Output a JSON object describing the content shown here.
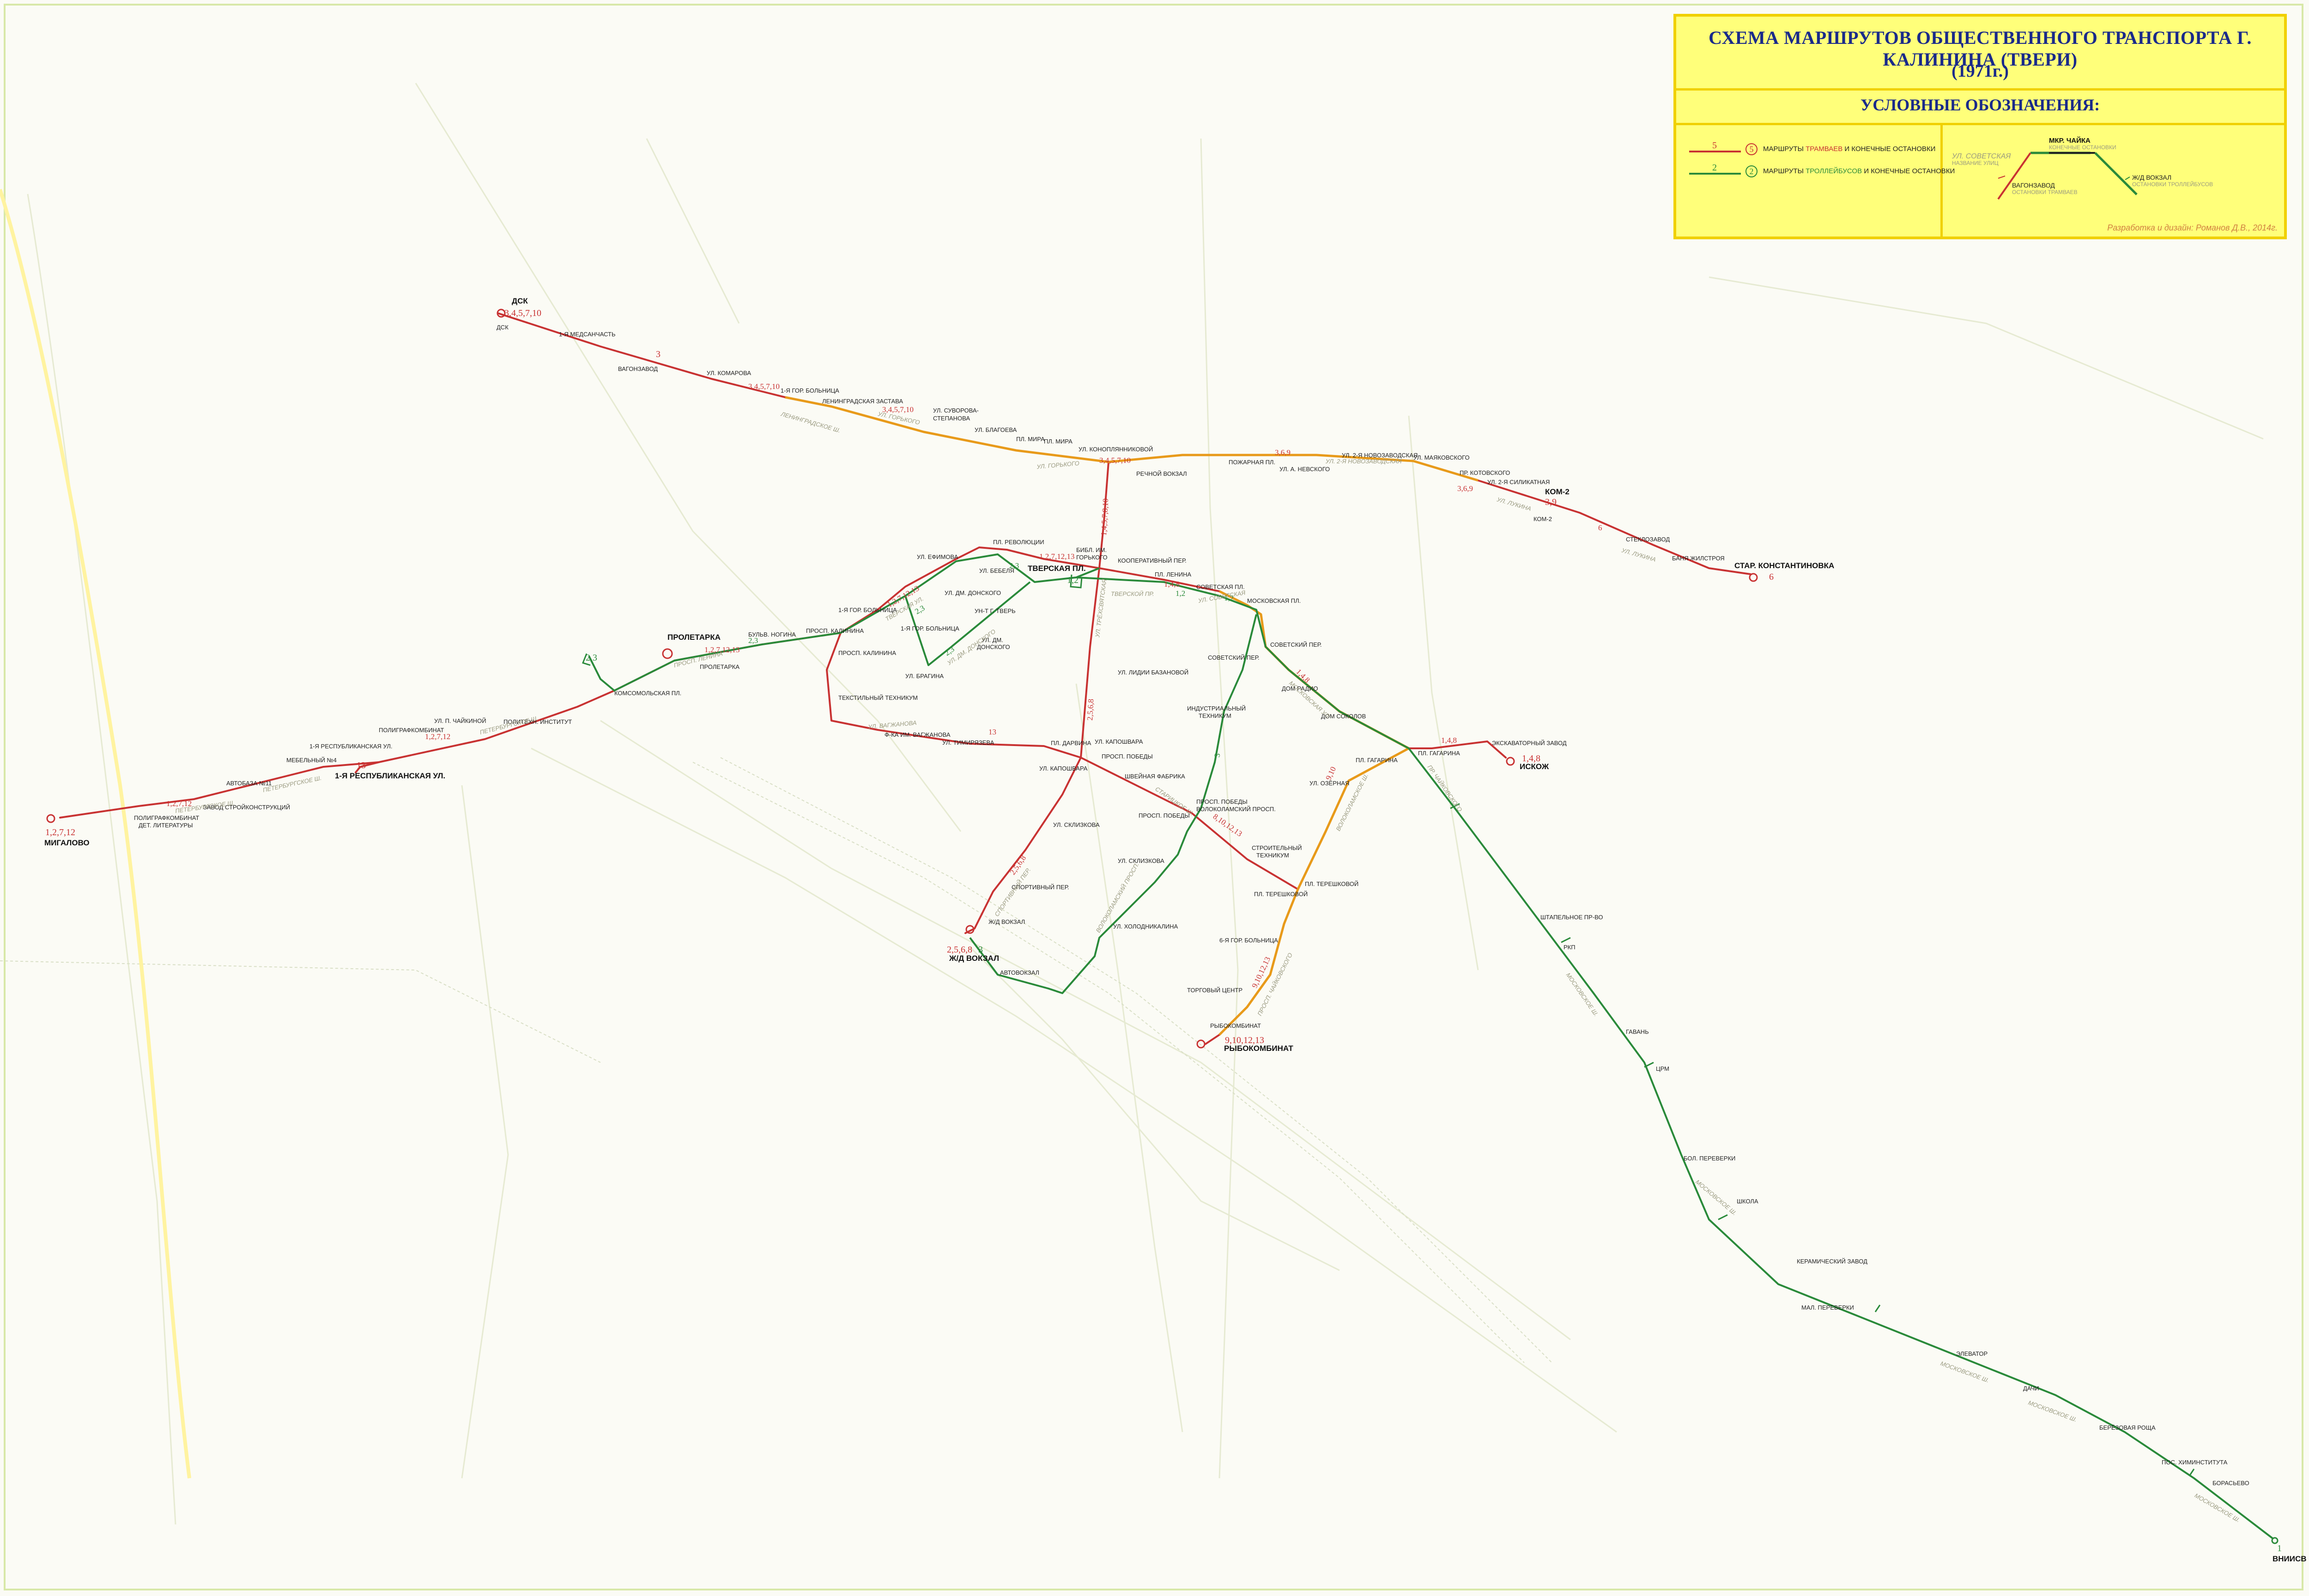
{
  "legend": {
    "title": "СХЕМА МАРШРУТОВ ОБЩЕСТВЕННОГО ТРАНСПОРТА Г. КАЛИНИНА (ТВЕРИ)",
    "year": "(1971г.)",
    "heading": "УСЛОВНЫЕ ОБОЗНАЧЕНИЯ:",
    "tram_row": {
      "num": "5",
      "circle": "5",
      "text_a": "МАРШРУТЫ ",
      "text_b": "ТРАМВАЕВ",
      "text_c": " И КОНЕЧНЫЕ ОСТАНОВКИ"
    },
    "trolley_row": {
      "num": "2",
      "circle": "2",
      "text_a": "МАРШРУТЫ ",
      "text_b": "ТРОЛЛЕЙБУСОВ",
      "text_c": " И КОНЕЧНЫЕ ОСТАНОВКИ"
    },
    "example": {
      "terminal": "МКР. ЧАЙКА",
      "terminal_sub": "КОНЕЧНЫЕ ОСТАНОВКИ",
      "street": "УЛ. СОВЕТСКАЯ",
      "street_sub": "НАЗВАНИЕ УЛИЦ",
      "tram_stop": "ВАГОНЗАВОД",
      "tram_stop_sub": "ОСТАНОВКИ ТРАМВАЕВ",
      "trolley_stop": "Ж/Д ВОКЗАЛ",
      "trolley_stop_sub": "ОСТАНОВКИ ТРОЛЛЕЙБУСОВ"
    },
    "credit": "Разработка и дизайн: Романов Д.В., 2014г."
  },
  "colors": {
    "tram": "#c83232",
    "trolley": "#2a8a3a",
    "shared": "#e89a1a",
    "legend_bg": "#ffff7a",
    "legend_border": "#f0d000",
    "title_blue": "#1a2a8a"
  },
  "terminals": {
    "dsk": {
      "name": "ДСК",
      "routes": "3,4,5,7,10"
    },
    "migalovo": {
      "name": "МИГАЛОВО",
      "routes": "1,2,7,12"
    },
    "resp": {
      "name": "1-Я РЕСПУБЛИКАНСКАЯ УЛ.",
      "routes": "13"
    },
    "proletarka": {
      "name": "ПРОЛЕТАРКА",
      "routes": "2,3"
    },
    "zhd": {
      "name": "Ж/Д ВОКЗАЛ",
      "routes": "2,5,6,8",
      "trolley": "3"
    },
    "rybokombinat": {
      "name": "РЫБОКОМБИНАТ",
      "routes": "9,10,12,13"
    },
    "iskozh": {
      "name": "ИСКОЖ",
      "routes": "1,4,8"
    },
    "starkonst": {
      "name": "СТАР. КОНСТАНТИНОВКА",
      "routes": "6"
    },
    "kom2": {
      "name": "КОМ-2",
      "routes": "3,9"
    },
    "vniisv": {
      "name": "ВНИИСВ",
      "trolley": "1"
    },
    "tverskaya": {
      "name": "ТВЕРСКАЯ ПЛ.",
      "trolley": "1,2"
    }
  },
  "route_labels": {
    "a": "3",
    "b": "3,4,5,7,10",
    "c": "3,4,5,7,10",
    "d": "3,4,5,7,10",
    "e": "3,6,9",
    "f": "3,6,9",
    "g": "6",
    "h": "1,4,5,7,8,10",
    "i": "1,4,8",
    "j": "1,4,8",
    "k": "1,2,7,12,13",
    "l": "1,2,7,12,13",
    "m": "1,2,7,12",
    "n": "1,2,7,12,13",
    "o": "2,5,6,8",
    "p": "2,5,6,8,9,10,12,13",
    "q": "8,10,12,13",
    "r": "9,10,12,13",
    "s": "13",
    "t": "1,4,8",
    "u": "3,9",
    "v": "1,2,7,12",
    "w": "9,10"
  },
  "trolley_labels": {
    "a": "2,3",
    "b": "1,2",
    "c": "2,3",
    "d": "2,3",
    "e": "1,2",
    "f": "3",
    "g": "1",
    "h": "2,3"
  },
  "stops": {
    "s1": "1-Я МЕДСАНЧАСТЬ",
    "s2": "ВАГОНЗАВОД",
    "s3": "УЛ. КОМАРОВА",
    "s4": "1-Я ГОР. БОЛЬНИЦА",
    "s5": "ЛЕНИНГРАДСКАЯ ЗАСТАВА",
    "s6": "УЛ. СУВОРОВА-",
    "s6b": "СТЕПАНОВА",
    "s7": "УЛ. БЛАГОЕВА",
    "s8": "ПЛ. МИРА",
    "s9": "ПЛ. МИРА",
    "s10": "УЛ. КОНОПЛЯННИКОВОЙ",
    "s11": "РЕЧНОЙ ВОКЗАЛ",
    "s12": "ПОЖАРНАЯ ПЛ.",
    "s13": "УЛ. А. НЕВСКОГО",
    "s14": "УЛ. 2-Я НОВОЗАВОДСКАЯ",
    "s15": "УЛ. МАЯКОВСКОГО",
    "s16": "ПР. КОТОВСКОГО",
    "s17": "УЛ. 2-Я СИЛИКАТНАЯ",
    "s18": "КОМ-2",
    "s19": "СТЕКЛОЗАВОД",
    "s20": "БАНЯ ЖИЛСТРОЯ",
    "s21": "ПЛ. РЕВОЛЮЦИИ",
    "s22": "БИБЛ. ИМ.",
    "s22b": "ГОРЬКОГО",
    "s23": "КООПЕРАТИВНЫЙ ПЕР.",
    "s24": "ПЛ. ЛЕНИНА",
    "s25": "СОВЕТСКАЯ ПЛ.",
    "s26": "МОСКОВСКАЯ ПЛ.",
    "s27": "УЛ. ЕФИМОВА",
    "s28": "УЛ. БЕБЕЛЯ",
    "s29": "УЛ. ДМ. ДОНСКОГО",
    "s30": "1-Я ГОР. БОЛЬНИЦА",
    "s31": "1-Я ГОР. БОЛЬНИЦА",
    "s32": "УН-Т Г. ТВЕРЬ",
    "s33": "УЛ. ДМ.",
    "s33b": "ДОНСКОГО",
    "s34": "ПРОСП. КАЛИНИНА",
    "s35": "ПРОСП. КАЛИНИНА",
    "s36": "УЛ. БРАГИНА",
    "s37": "БУЛЬВ. НОГИНА",
    "s38": "ПРОЛЕТАРКА",
    "s39": "КОМСОМОЛЬСКАЯ ПЛ.",
    "s40": "УЛ. П. ЧАЙКИНОЙ",
    "s41": "ПОЛИТЕХН. ИНСТИТУТ",
    "s42": "ПОЛИГРАФКОМБИНАТ",
    "s43": "1-Я РЕСПУБЛИКАНСКАЯ УЛ.",
    "s44": "МЕБЕЛЬНЫЙ №4",
    "s45": "АВТОБАЗА №11",
    "s46": "ЗАВОД СТРОЙКОНСТРУКЦИЙ",
    "s47": "ПОЛИГРАФКОМБИНАТ",
    "s47b": "ДЕТ. ЛИТЕРАТУРЫ",
    "s48": "ТЕКСТИЛЬНЫЙ ТЕХНИКУМ",
    "s49": "Ф-КА ИМ. ВАГЖАНОВА",
    "s50": "УЛ. ТИМИРЯЗЕВА",
    "s51": "ПЛ. ДАРВИНА",
    "s52": "УЛ. КАПОШВАРА",
    "s53": "ПРОСП. ПОБЕДЫ",
    "s54": "УЛ. КАПОШВАРА",
    "s55": "ШВЕЙНАЯ ФАБРИКА",
    "s56": "УЛ. ЛИДИИ БАЗАНОВОЙ",
    "s57": "ИНДУСТРИАЛЬНЫЙ",
    "s57b": "ТЕХНИКУМ",
    "s58": "СОВЕТСКИЙ ПЕР.",
    "s59": "СОВЕТСКИЙ ПЕР.",
    "s60": "ДОМ РАДИО",
    "s61": "ДОМ СОКОЛОВ",
    "s62": "ПЛ. ГАГАРИНА",
    "s63": "ПЛ. ГАГАРИНА",
    "s64": "ЭКСКАВАТОРНЫЙ ЗАВОД",
    "s65": "ПРОСП. ПОБЕДЫ",
    "s66": "ВОЛОКОЛАМСКИЙ ПРОСП.",
    "s67": "ПРОСП. ПОБЕДЫ",
    "s68": "СТРОИТЕЛЬНЫЙ",
    "s68b": "ТЕХНИКУМ",
    "s69": "ПЛ. ТЕРЕШКОВОЙ",
    "s70": "УЛ. ОЗЁРНАЯ",
    "s71": "УЛ. СКЛИЗКОВА",
    "s72": "УЛ. СКЛИЗКОВА",
    "s73": "СПОРТИВНЫЙ ПЕР.",
    "s74": "Ж/Д ВОКЗАЛ",
    "s75": "УЛ. ХОЛОДНИКАЛИНА",
    "s76": "АВТОВОКЗАЛ",
    "s77": "6-Я ГОР. БОЛЬНИЦА",
    "s78": "ТОРГОВЫЙ ЦЕНТР",
    "s79": "РЫБОКОМБИНАТ",
    "s80": "ШТАПЕЛЬНОЕ ПР-ВО",
    "s81": "РКП",
    "s82": "ГАВАНЬ",
    "s83": "ЦРМ",
    "s84": "БОЛ. ПЕРЕВЕРКИ",
    "s85": "ШКОЛА",
    "s86": "КЕРАМИЧЕСКИЙ ЗАВОД",
    "s87": "МАЛ. ПЕРЕВЕРКИ",
    "s88": "ЭЛЕВАТОР",
    "s89": "ДАЧИ",
    "s90": "БЕРЁЗОВАЯ РОЩА",
    "s91": "ПОС. ХИМИНСТИТУТА",
    "s92": "БОРАСЬЕВО",
    "s93": "ДСК",
    "s94": "ТВЕРСКАЯ ПЛ.",
    "s95": "СТАР. КОНСТАНТИНОВКА",
    "s96": "ИСКОЖ",
    "s97": "МИГАЛОВО",
    "s98": "РЫБОКОМБИНАТ",
    "s99": "Ж/Д ВОКЗАЛ"
  },
  "streets": {
    "t1": "ЛЕНИНГРАДСКОЕ Ш.",
    "t2": "УЛ. ГОРЬКОГО",
    "t3": "УЛ. ГОРЬКОГО",
    "t4": "УЛ. ГОРЬКОГО",
    "t5": "НАБЕРЕЖНАЯ",
    "t6": "УЛ. 2-Я НОВОЗАВОДСКАЯ",
    "t7": "УЛ. ЛУКИНА",
    "t8": "УЛ. ЛУКИНА",
    "t9": "УЛ. ТРЁХСВЯТСКАЯ",
    "t10": "УЛ. СОВЕТСКАЯ",
    "t11": "ТВЕРСКОЙ ПР.",
    "t12": "УЛ. СОВЕТСКАЯ",
    "t13": "МОСКОВСКАЯ УЛ.",
    "t14": "ПР. ЧАЙКОВСКОГО",
    "t15": "ВОЛОКОЛАМСКОЕ Ш.",
    "t16": "СТАРИЦКОЕ Ш.",
    "t17": "УЛ. КОНСТИТУЦИИ",
    "t18": "СПОРТИВНЫЙ ПЕР.",
    "t19": "МОСКОВСКОЕ Ш.",
    "t20": "МОСКОВСКОЕ Ш.",
    "t21": "МОСКОВСКОЕ Ш.",
    "t22": "МОСКОВСКОЕ Ш.",
    "t23": "МОСКОВСКОЕ Ш.",
    "t24": "ВОЛОКОЛАМСКИЙ ПРОСП.",
    "t25": "ПРОСП. ЧАЙКОВСКОГО",
    "t26": "УЛ. ВАГЖАНОВА",
    "t27": "ПЕТЕРБУРГСКОЕ Ш.",
    "t28": "ПЕТЕРБУРГСКОЕ Ш.",
    "t29": "ПЕТЕРБУРГСКОЕ Ш.",
    "t30": "ПРОСП. ЛЕНИНА",
    "t31": "ПРОСП. ЛЕНИНА",
    "t32": "УЛ. СТАРОБЕССОВСКАЯ",
    "t33": "ТВЕРСКАЯ УЛ.",
    "t34": "УЛ. ВОЛОДАРСКОГО",
    "t35": "СОЛОДОВ ПЕР.",
    "t36": "УЛ. ДМ. ДОНСКОГО"
  }
}
